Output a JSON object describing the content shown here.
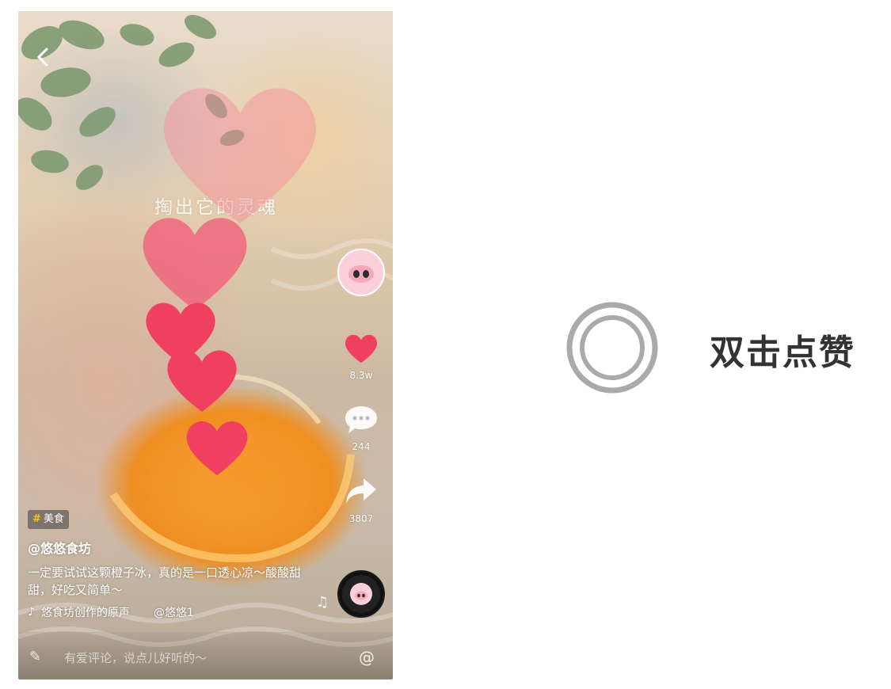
{
  "video": {
    "overlay_text": "掏出它的灵魂",
    "back_icon": "chevron-left-icon"
  },
  "actions": {
    "likes": "8.3w",
    "comments": "244",
    "shares": "3807"
  },
  "info": {
    "tag_hash": "#",
    "tag_label": "美食",
    "username": "@悠悠食坊",
    "caption": "一定要试试这颗橙子冰，真的是一口透心凉～酸酸甜甜，好吃又简单～",
    "music_title": "悠食坊创作的原声",
    "music_author": "@悠悠1"
  },
  "comment_bar": {
    "placeholder": "有爱评论，说点儿好听的～",
    "at_symbol": "@"
  },
  "instruction": {
    "text": "双击点赞"
  },
  "colors": {
    "heart": "#f0405f",
    "tag_hash": "#f5c518",
    "instruction_text": "#333333",
    "gesture_ring": "#aaaaaa"
  }
}
